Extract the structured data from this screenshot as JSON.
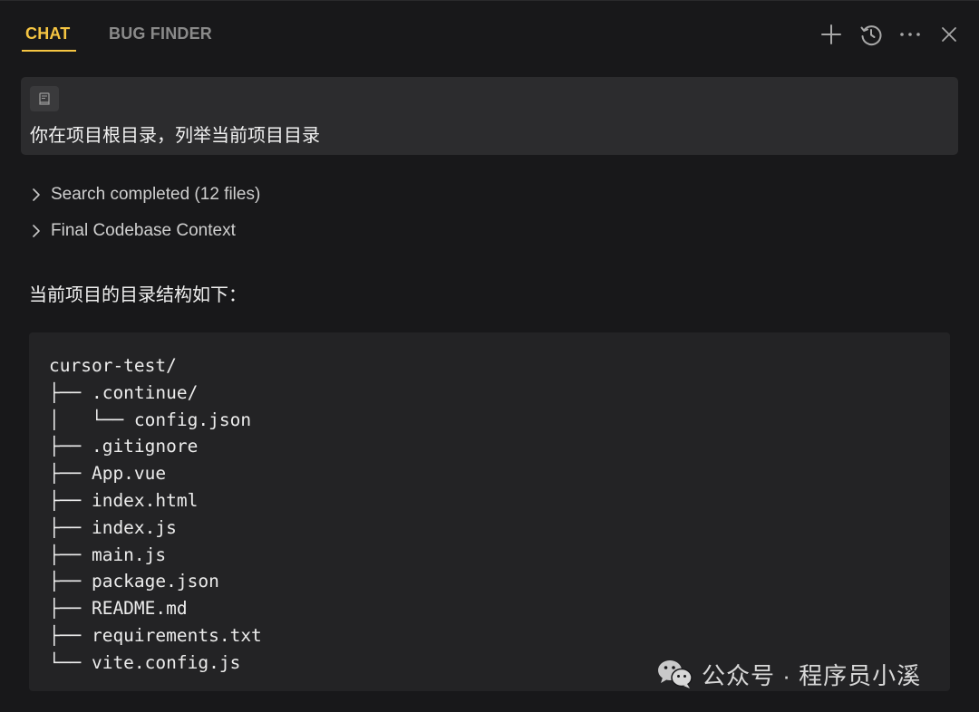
{
  "tabs": {
    "chat_label": "CHAT",
    "bug_finder_label": "BUG FINDER"
  },
  "header_icons": [
    "plus-icon",
    "history-icon",
    "more-icon",
    "close-icon"
  ],
  "colors": {
    "accent": "#f5c542",
    "background": "#18181a",
    "message_bg": "#2c2c2e",
    "code_bg": "#232325"
  },
  "user_message": {
    "context_icon": "file-context-icon",
    "text": "你在项目根目录，列举当前项目目录"
  },
  "steps": {
    "search": "Search completed (12 files)",
    "context": "Final Codebase Context"
  },
  "assistant": {
    "intro": "当前项目的目录结构如下："
  },
  "code_lines": [
    "cursor-test/",
    "├── .continue/",
    "│   └── config.json",
    "├── .gitignore",
    "├── App.vue",
    "├── index.html",
    "├── index.js",
    "├── main.js",
    "├── package.json",
    "├── README.md",
    "├── requirements.txt",
    "└── vite.config.js"
  ],
  "watermark": {
    "icon": "wechat-icon",
    "text": "公众号 · 程序员小溪"
  }
}
